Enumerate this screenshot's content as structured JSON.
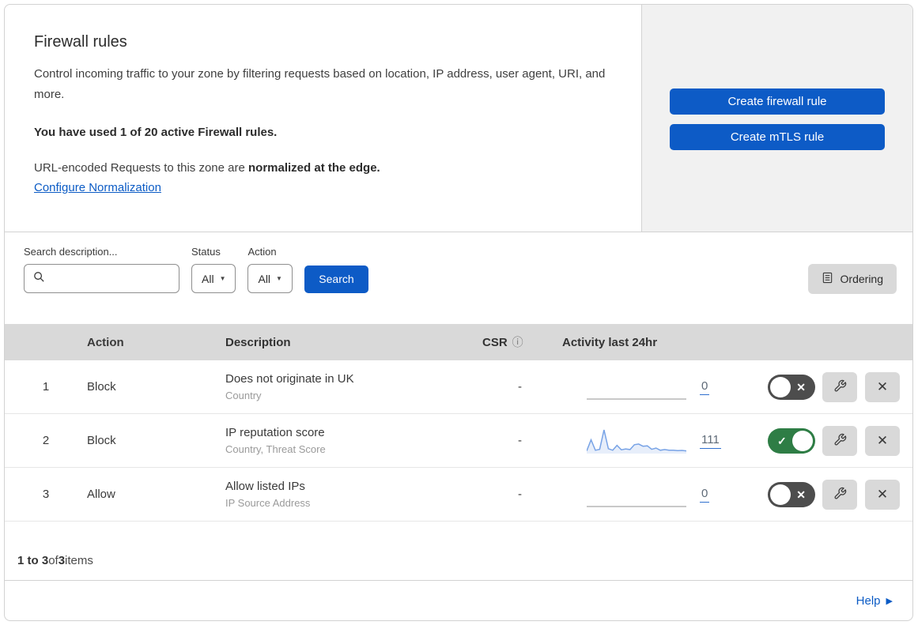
{
  "panel": {
    "title": "Firewall rules",
    "description": "Control incoming traffic to your zone by filtering requests based on location, IP address, user agent, URI, and more.",
    "usage": "You have used 1 of 20 active Firewall rules.",
    "normalization_text": "URL-encoded Requests to this zone are ",
    "normalization_bold": "normalized at the edge.",
    "normalization_link": "Configure Normalization"
  },
  "actions": {
    "create_firewall_rule": "Create firewall rule",
    "create_mtls_rule": "Create mTLS rule"
  },
  "filters": {
    "search_label": "Search description...",
    "search_value": "",
    "status_label": "Status",
    "status_value": "All",
    "action_label": "Action",
    "action_value": "All",
    "search_button": "Search",
    "ordering_button": "Ordering"
  },
  "table": {
    "headers": {
      "action": "Action",
      "description": "Description",
      "csr": "CSR",
      "activity": "Activity last 24hr"
    },
    "rows": [
      {
        "index": "1",
        "action": "Block",
        "description": "Does not originate in UK",
        "fields": "Country",
        "csr": "-",
        "activity_count": "0",
        "enabled": false,
        "sparkline": []
      },
      {
        "index": "2",
        "action": "Block",
        "description": "IP reputation score",
        "fields": "Country, Threat Score",
        "csr": "-",
        "activity_count": "111",
        "enabled": true,
        "sparkline": [
          5,
          55,
          8,
          12,
          100,
          15,
          8,
          30,
          10,
          14,
          11,
          33,
          36,
          26,
          28,
          12,
          18,
          8,
          11,
          8,
          8,
          6,
          7,
          5
        ]
      },
      {
        "index": "3",
        "action": "Allow",
        "description": "Allow listed IPs",
        "fields": "IP Source Address",
        "csr": "-",
        "activity_count": "0",
        "enabled": false,
        "sparkline": []
      }
    ]
  },
  "footer": {
    "range": "1 to 3",
    "of": " of ",
    "total": "3",
    "items": " items"
  },
  "help": {
    "label": "Help"
  },
  "colors": {
    "accent_blue": "#0d5bc6",
    "link_blue": "#0b5bc5",
    "toggle_on_green": "#2e7d45",
    "toggle_off_gray": "#4d4d4d",
    "sparkline": "#78a3e6",
    "sparkline_fill": "rgba(120,163,230,0.18)",
    "header_gray": "#d9d9d9",
    "panel_gray": "#f1f1f1"
  }
}
